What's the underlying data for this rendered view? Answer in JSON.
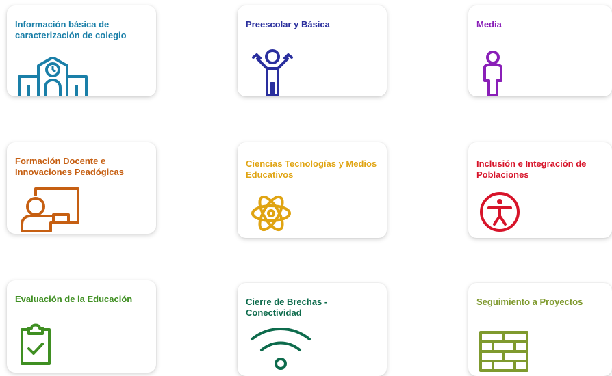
{
  "cards": [
    {
      "id": "caracterizacion",
      "title": "Información básica de caracterización de colegio",
      "color": "#1a7fa8",
      "icon": "school-building-icon"
    },
    {
      "id": "preescolar",
      "title": "Preescolar y Básica",
      "color": "#2a2f9e",
      "icon": "child-icon"
    },
    {
      "id": "media",
      "title": "Media",
      "color": "#8a1fb8",
      "icon": "teenager-icon"
    },
    {
      "id": "formacion",
      "title": "Formación Docente e Innovaciones Peadógicas",
      "color": "#c65f12",
      "icon": "teacher-board-icon"
    },
    {
      "id": "ciencias",
      "title": "Ciencias Tecnologías y Medios Educativos",
      "color": "#e0a412",
      "icon": "atom-icon"
    },
    {
      "id": "inclusion",
      "title": "Inclusión e Integración de Poblaciones",
      "color": "#d7142a",
      "icon": "accessibility-icon"
    },
    {
      "id": "evaluacion",
      "title": "Evaluación de la Educación",
      "color": "#3f8f22",
      "icon": "clipboard-check-icon"
    },
    {
      "id": "brechas",
      "title": "Cierre de Brechas - Conectividad",
      "color": "#0d6b4c",
      "icon": "wifi-icon"
    },
    {
      "id": "seguimiento",
      "title": "Seguimiento a Proyectos",
      "color": "#7f9a2e",
      "icon": "brick-wall-icon"
    }
  ]
}
